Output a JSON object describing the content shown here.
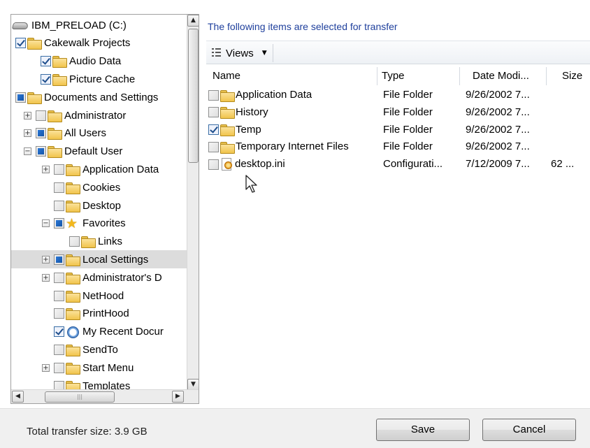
{
  "tree": {
    "items": [
      {
        "label": "IBM_PRELOAD (C:)",
        "level": 0,
        "expander": "none",
        "checkbox": "none",
        "icon": "drive-icon"
      },
      {
        "label": "Cakewalk Projects",
        "level": 0,
        "expander": "none",
        "checkbox": "checked",
        "icon": "folder-icon"
      },
      {
        "label": "Audio Data",
        "level": 1,
        "expander": "none",
        "checkbox": "checked",
        "icon": "folder-icon"
      },
      {
        "label": "Picture Cache",
        "level": 1,
        "expander": "none",
        "checkbox": "checked",
        "icon": "folder-icon"
      },
      {
        "label": "Documents and Settings",
        "level": 0,
        "expander": "none",
        "checkbox": "partial",
        "icon": "folder-icon"
      },
      {
        "label": "Administrator",
        "level": 1,
        "expander": "+",
        "checkbox": "unchecked",
        "icon": "folder-icon"
      },
      {
        "label": "All Users",
        "level": 1,
        "expander": "+",
        "checkbox": "partial",
        "icon": "folder-icon"
      },
      {
        "label": "Default User",
        "level": 1,
        "expander": "−",
        "checkbox": "partial",
        "icon": "folder-icon"
      },
      {
        "label": "Application Data",
        "level": 2,
        "expander": "+",
        "checkbox": "unchecked",
        "icon": "folder-icon"
      },
      {
        "label": "Cookies",
        "level": 2,
        "expander": "none",
        "checkbox": "unchecked",
        "icon": "folder-icon"
      },
      {
        "label": "Desktop",
        "level": 2,
        "expander": "none",
        "checkbox": "unchecked",
        "icon": "folder-icon"
      },
      {
        "label": "Favorites",
        "level": 2,
        "expander": "−",
        "checkbox": "partial",
        "icon": "star-icon"
      },
      {
        "label": "Links",
        "level": 3,
        "expander": "none",
        "checkbox": "unchecked",
        "icon": "folder-icon"
      },
      {
        "label": "Local Settings",
        "level": 2,
        "expander": "+",
        "checkbox": "partial",
        "icon": "folder-icon",
        "selected": true
      },
      {
        "label": "Administrator's D",
        "level": 2,
        "expander": "+",
        "checkbox": "unchecked",
        "icon": "folder-icon"
      },
      {
        "label": "NetHood",
        "level": 2,
        "expander": "none",
        "checkbox": "unchecked",
        "icon": "folder-icon"
      },
      {
        "label": "PrintHood",
        "level": 2,
        "expander": "none",
        "checkbox": "unchecked",
        "icon": "folder-icon"
      },
      {
        "label": "My Recent Docur",
        "level": 2,
        "expander": "none",
        "checkbox": "checked",
        "icon": "recent-documents-icon"
      },
      {
        "label": "SendTo",
        "level": 2,
        "expander": "none",
        "checkbox": "unchecked",
        "icon": "folder-icon"
      },
      {
        "label": "Start Menu",
        "level": 2,
        "expander": "+",
        "checkbox": "unchecked",
        "icon": "folder-icon"
      },
      {
        "label": "Templates",
        "level": 2,
        "expander": "none",
        "checkbox": "unchecked",
        "icon": "folder-icon"
      }
    ]
  },
  "list": {
    "caption": "The following items are selected for transfer",
    "views_label": "Views",
    "columns": {
      "name": "Name",
      "type": "Type",
      "date": "Date Modi...",
      "size": "Size"
    },
    "rows": [
      {
        "name": "Application Data",
        "type": "File Folder",
        "date": "9/26/2002 7...",
        "size": "",
        "checked": false,
        "icon": "folder-icon"
      },
      {
        "name": "History",
        "type": "File Folder",
        "date": "9/26/2002 7...",
        "size": "",
        "checked": false,
        "icon": "folder-icon"
      },
      {
        "name": "Temp",
        "type": "File Folder",
        "date": "9/26/2002 7...",
        "size": "",
        "checked": true,
        "icon": "folder-icon"
      },
      {
        "name": "Temporary Internet Files",
        "type": "File Folder",
        "date": "9/26/2002 7...",
        "size": "",
        "checked": false,
        "icon": "folder-icon"
      },
      {
        "name": "desktop.ini",
        "type": "Configurati...",
        "date": "7/12/2009 7...",
        "size": "62 ...",
        "checked": false,
        "icon": "ini-file-icon"
      }
    ]
  },
  "footer": {
    "total_size": "Total transfer size: 3.9 GB",
    "save_label": "Save",
    "cancel_label": "Cancel"
  }
}
